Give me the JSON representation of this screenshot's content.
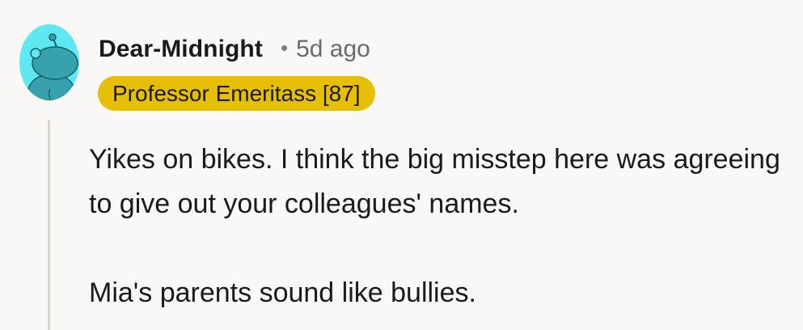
{
  "comment": {
    "author": "Dear-Midnight",
    "separator": "•",
    "timestamp": "5d ago",
    "flair": "Professor Emeritass [87]",
    "avatar_icon": "reddit-snoo-avatar-icon",
    "paragraphs": [
      "Yikes on bikes. I think the big misstep here was agreeing to give out your colleagues' names.",
      "Mia's parents sound like bullies."
    ]
  },
  "colors": {
    "background": "#faf8f6",
    "avatar_bg": "#5ee9f2",
    "avatar_figure": "#37a2ae",
    "flair_bg": "#e6bf05",
    "thread_line": "#dcd6d0"
  }
}
